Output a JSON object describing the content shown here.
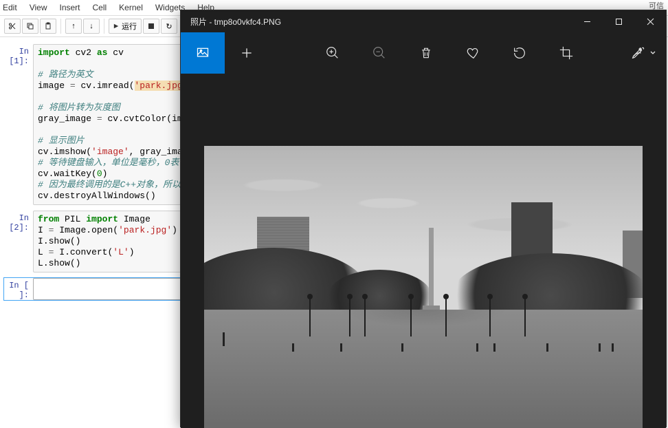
{
  "jupyter": {
    "menus": [
      "Edit",
      "View",
      "Insert",
      "Cell",
      "Kernel",
      "Widgets",
      "Help"
    ],
    "toolbar": {
      "run_label": "运行"
    },
    "cells": [
      {
        "prompt": "In [1]:",
        "tokens": [
          [
            [
              "import",
              "kw-green"
            ],
            [
              " ",
              ""
            ],
            [
              "cv2",
              "id"
            ],
            [
              " ",
              ""
            ],
            [
              "as",
              "kw-as"
            ],
            [
              " ",
              ""
            ],
            [
              "cv",
              "id"
            ]
          ],
          [],
          [
            [
              "# 路径为英文",
              "comment"
            ]
          ],
          [
            [
              "image",
              "id"
            ],
            [
              " ",
              ""
            ],
            [
              "=",
              "op"
            ],
            [
              " ",
              ""
            ],
            [
              "cv",
              "id"
            ],
            [
              ".",
              ""
            ],
            [
              "imread",
              "id"
            ],
            [
              "(",
              ""
            ],
            [
              "'park.jpg'",
              "str str-bg"
            ],
            [
              ")",
              ""
            ]
          ],
          [],
          [
            [
              "# 将图片转为灰度图",
              "comment"
            ]
          ],
          [
            [
              "gray_image",
              "id"
            ],
            [
              " ",
              ""
            ],
            [
              "=",
              "op"
            ],
            [
              " ",
              ""
            ],
            [
              "cv",
              "id"
            ],
            [
              ".",
              ""
            ],
            [
              "cvtColor",
              "id"
            ],
            [
              "(",
              ""
            ],
            [
              "image",
              "id"
            ],
            [
              ",",
              ""
            ]
          ],
          [],
          [
            [
              "# 显示图片",
              "comment"
            ]
          ],
          [
            [
              "cv",
              "id"
            ],
            [
              ".",
              ""
            ],
            [
              "imshow",
              "id"
            ],
            [
              "(",
              ""
            ],
            [
              "'image'",
              "str"
            ],
            [
              ",",
              ""
            ],
            [
              " ",
              ""
            ],
            [
              "gray_image",
              "id"
            ],
            [
              ")",
              ""
            ]
          ],
          [
            [
              "# 等待键盘输入，单位是毫秒，0表",
              "comment"
            ]
          ],
          [
            [
              "cv",
              "id"
            ],
            [
              ".",
              ""
            ],
            [
              "waitKey",
              "id"
            ],
            [
              "(",
              ""
            ],
            [
              "0",
              "num"
            ],
            [
              ")",
              ""
            ]
          ],
          [
            [
              "# 因为最终调用的是C++对象，所以",
              "comment"
            ]
          ],
          [
            [
              "cv",
              "id"
            ],
            [
              ".",
              ""
            ],
            [
              "destroyAllWindows",
              "id"
            ],
            [
              "(",
              ""
            ],
            [
              ")",
              ""
            ]
          ]
        ]
      },
      {
        "prompt": "In [2]:",
        "tokens": [
          [
            [
              "from",
              "kw-green"
            ],
            [
              " ",
              ""
            ],
            [
              "PIL",
              "id"
            ],
            [
              " ",
              ""
            ],
            [
              "import",
              "kw-green"
            ],
            [
              " ",
              ""
            ],
            [
              "Image",
              "id"
            ]
          ],
          [
            [
              "I",
              "id"
            ],
            [
              " ",
              ""
            ],
            [
              "=",
              "op"
            ],
            [
              " ",
              ""
            ],
            [
              "Image",
              "id"
            ],
            [
              ".",
              ""
            ],
            [
              "open",
              "id"
            ],
            [
              "(",
              ""
            ],
            [
              "'park.jpg'",
              "str"
            ],
            [
              ")",
              ""
            ]
          ],
          [
            [
              "I",
              "id"
            ],
            [
              ".",
              ""
            ],
            [
              "show",
              "id"
            ],
            [
              "(",
              ""
            ],
            [
              ")",
              ""
            ]
          ],
          [
            [
              "L",
              "id"
            ],
            [
              " ",
              ""
            ],
            [
              "=",
              "op"
            ],
            [
              " ",
              ""
            ],
            [
              "I",
              "id"
            ],
            [
              ".",
              ""
            ],
            [
              "convert",
              "id"
            ],
            [
              "(",
              ""
            ],
            [
              "'L'",
              "str"
            ],
            [
              ")",
              ""
            ]
          ],
          [
            [
              "L",
              "id"
            ],
            [
              ".",
              ""
            ],
            [
              "show",
              "id"
            ],
            [
              "(",
              ""
            ],
            [
              ")",
              ""
            ]
          ]
        ]
      },
      {
        "prompt": "In [ ]:",
        "active": true,
        "empty": true,
        "tokens": [
          []
        ]
      }
    ]
  },
  "photos": {
    "title": "照片 - tmp8o0vkfc4.PNG",
    "icons": [
      "zoom-in",
      "zoom-out",
      "delete",
      "favorite",
      "rotate",
      "crop"
    ],
    "edit_label": "edit"
  },
  "corner_text": "可信"
}
